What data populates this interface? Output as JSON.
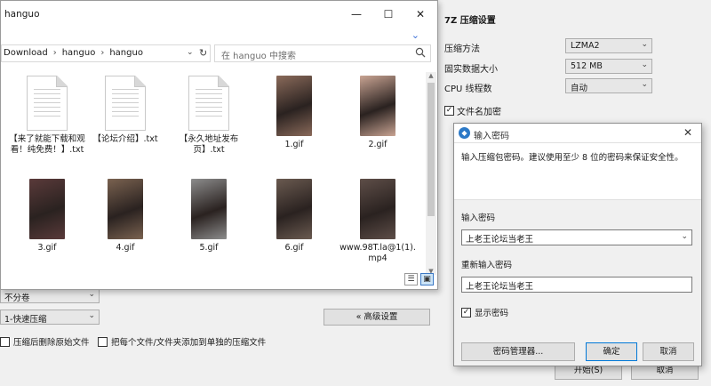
{
  "explorer": {
    "title": "hanguo",
    "controls": {
      "minimize": "—",
      "maximize": "☐",
      "close": "✕"
    },
    "breadcrumb": [
      "Download",
      "hanguo",
      "hanguo"
    ],
    "search_placeholder": "在 hanguo 中搜索",
    "files": [
      {
        "name": "【来了就能下载和观看！纯免费！】.txt",
        "kind": "doc"
      },
      {
        "name": "【论坛介绍】.txt",
        "kind": "doc"
      },
      {
        "name": "【永久地址发布页】.txt",
        "kind": "doc"
      },
      {
        "name": "1.gif",
        "kind": "photo",
        "color": "#8a6a5a"
      },
      {
        "name": "2.gif",
        "kind": "photo",
        "color": "#c9a493"
      },
      {
        "name": "3.gif",
        "kind": "photo",
        "color": "#5a3a3a"
      },
      {
        "name": "4.gif",
        "kind": "photo",
        "color": "#7a6250"
      },
      {
        "name": "5.gif",
        "kind": "photo",
        "color": "#8c8c8c"
      },
      {
        "name": "6.gif",
        "kind": "photo",
        "color": "#6a5a50"
      },
      {
        "name": "www.98T.la@1(1).mp4",
        "kind": "photo",
        "color": "#5e4e48"
      }
    ]
  },
  "zip": {
    "title": "7Z 压缩设置",
    "method_label": "压缩方法",
    "method_value": "LZMA2",
    "block_label": "固实数据大小",
    "block_value": "512 MB",
    "threads_label": "CPU 线程数",
    "threads_value": "自动",
    "encrypt_names_label": "文件名加密",
    "split_value": "不分卷",
    "level_value": "1-快速压缩",
    "advanced_label": "« 高级设置",
    "delete_after_label": "压缩后删除原始文件",
    "separate_label": "把每个文件/文件夹添加到单独的压缩文件",
    "start_label": "开始(S)",
    "cancel_label": "取消"
  },
  "password_dialog": {
    "title": "输入密码",
    "close": "✕",
    "description": "输入压缩包密码。建议使用至少 8 位的密码来保证安全性。",
    "password_label": "输入密码",
    "password_value": "上老王论坛当老王",
    "confirm_label": "重新输入密码",
    "confirm_value": "上老王论坛当老王",
    "show_label": "显示密码",
    "manager_button": "密码管理器...",
    "ok_button": "确定",
    "cancel_button": "取消"
  },
  "colors": {
    "accent": "#0078d7",
    "folder_accent": "#3a6fd8"
  }
}
